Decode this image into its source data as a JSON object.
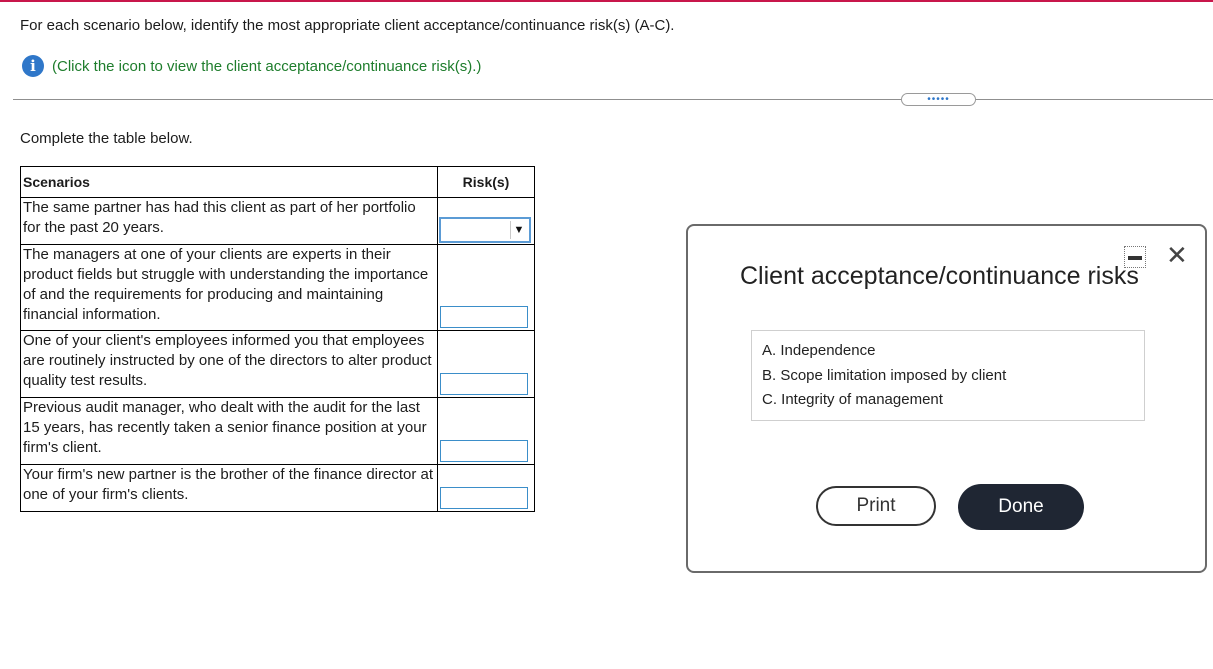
{
  "colors": {
    "accent_top_bar": "#c8174b",
    "info_blue": "#2f77c9",
    "link_green": "#1e7d2c",
    "done_button": "#1f2633"
  },
  "instructions": "For each scenario below, identify the most appropriate client acceptance/continuance risk(s) (A-C).",
  "info": {
    "icon": "info-icon",
    "link_text": "(Click the icon to view the client acceptance/continuance risk(s).)"
  },
  "divider_handle": "•••••",
  "complete_label": "Complete the table below.",
  "table": {
    "headers": {
      "scenarios": "Scenarios",
      "risks": "Risk(s)"
    },
    "rows": [
      {
        "scenario": "The same partner has had this client as part of her portfolio for the past 20 years.",
        "risk": ""
      },
      {
        "scenario": "The managers at one of your clients are experts in their product fields but struggle with understanding the importance of and the requirements for producing and maintaining financial information.",
        "risk": ""
      },
      {
        "scenario": "One of your client's employees informed you that employees are routinely instructed by one of the directors to alter product quality test results.",
        "risk": ""
      },
      {
        "scenario": "Previous audit manager, who dealt with the audit for the last 15 years, has recently taken a senior finance position at your firm's client.",
        "risk": ""
      },
      {
        "scenario": "Your firm's new partner is the brother of the finance director at one of your firm's clients.",
        "risk": ""
      }
    ]
  },
  "modal": {
    "title": "Client acceptance/continuance risks",
    "risks": [
      "A. Independence",
      "B. Scope limitation imposed by client",
      "C. Integrity of management"
    ],
    "print_label": "Print",
    "done_label": "Done",
    "close_icon": "close-icon",
    "minimize_icon": "minimize-icon"
  }
}
